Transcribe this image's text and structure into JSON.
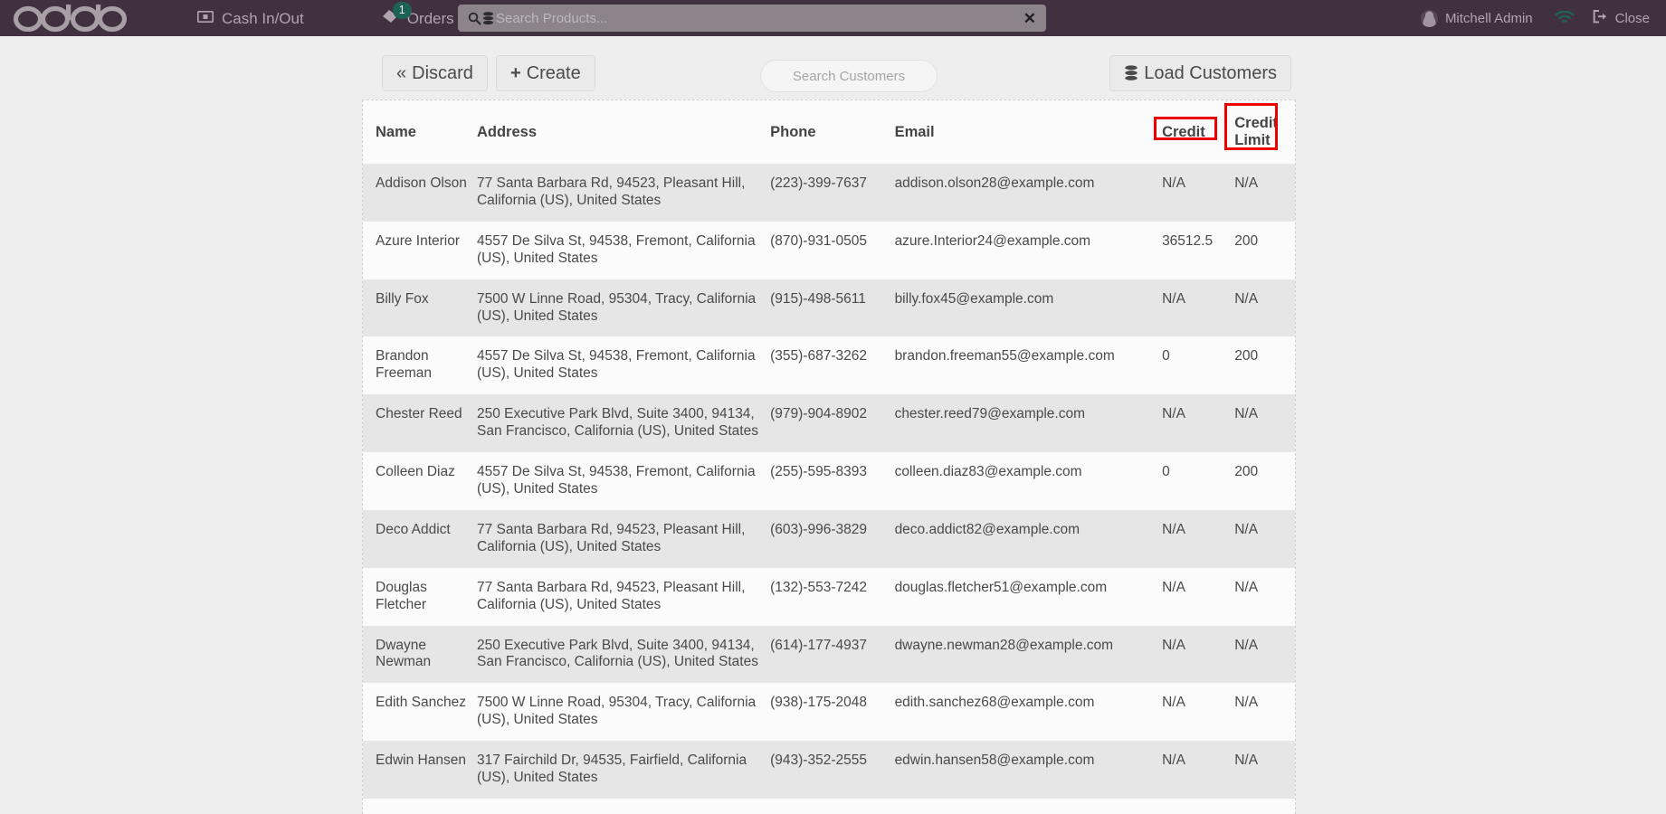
{
  "topbar": {
    "brand": "odoo",
    "cash_in_out": "Cash In/Out",
    "orders": "Orders",
    "orders_badge": "1",
    "search_placeholder": "Search Products...",
    "search_value": "",
    "user_name": "Mitchell Admin",
    "close_label": "Close",
    "bg_color": "#41303f",
    "text_color": "#b0a5af",
    "badge_color": "#1d6355"
  },
  "toolbar": {
    "discard_label": "Discard",
    "create_label": "Create",
    "search_customers_placeholder": "Search Customers",
    "load_customers_label": "Load Customers"
  },
  "table": {
    "headers": {
      "name": "Name",
      "address": "Address",
      "phone": "Phone",
      "email": "Email",
      "credit": "Credit",
      "credit_limit": "Credit Limit"
    },
    "highlight_color": "#ee0000",
    "rows": [
      {
        "name": "Addison Olson",
        "address": "77 Santa Barbara Rd, 94523, Pleasant Hill, California (US), United States",
        "phone": "(223)-399-7637",
        "email": "addison.olson28@example.com",
        "credit": "N/A",
        "credit_limit": "N/A",
        "limit_alert": false
      },
      {
        "name": "Azure Interior",
        "address": "4557 De Silva St, 94538, Fremont, California (US), United States",
        "phone": "(870)-931-0505",
        "email": "azure.Interior24@example.com",
        "credit": "36512.5",
        "credit_limit": "200",
        "limit_alert": true
      },
      {
        "name": "Billy Fox",
        "address": "7500 W Linne Road, 95304, Tracy, California (US), United States",
        "phone": "(915)-498-5611",
        "email": "billy.fox45@example.com",
        "credit": "N/A",
        "credit_limit": "N/A",
        "limit_alert": false
      },
      {
        "name": "Brandon Freeman",
        "address": "4557 De Silva St, 94538, Fremont, California (US), United States",
        "phone": "(355)-687-3262",
        "email": "brandon.freeman55@example.com",
        "credit": "0",
        "credit_limit": "200",
        "limit_alert": false
      },
      {
        "name": "Chester Reed",
        "address": "250 Executive Park Blvd, Suite 3400, 94134, San Francisco, California (US), United States",
        "phone": "(979)-904-8902",
        "email": "chester.reed79@example.com",
        "credit": "N/A",
        "credit_limit": "N/A",
        "limit_alert": false
      },
      {
        "name": "Colleen Diaz",
        "address": "4557 De Silva St, 94538, Fremont, California (US), United States",
        "phone": "(255)-595-8393",
        "email": "colleen.diaz83@example.com",
        "credit": "0",
        "credit_limit": "200",
        "limit_alert": false
      },
      {
        "name": "Deco Addict",
        "address": "77 Santa Barbara Rd, 94523, Pleasant Hill, California (US), United States",
        "phone": "(603)-996-3829",
        "email": "deco.addict82@example.com",
        "credit": "N/A",
        "credit_limit": "N/A",
        "limit_alert": false
      },
      {
        "name": "Douglas Fletcher",
        "address": "77 Santa Barbara Rd, 94523, Pleasant Hill, California (US), United States",
        "phone": "(132)-553-7242",
        "email": "douglas.fletcher51@example.com",
        "credit": "N/A",
        "credit_limit": "N/A",
        "limit_alert": false
      },
      {
        "name": "Dwayne Newman",
        "address": "250 Executive Park Blvd, Suite 3400, 94134, San Francisco, California (US), United States",
        "phone": "(614)-177-4937",
        "email": "dwayne.newman28@example.com",
        "credit": "N/A",
        "credit_limit": "N/A",
        "limit_alert": false
      },
      {
        "name": "Edith Sanchez",
        "address": "7500 W Linne Road, 95304, Tracy, California (US), United States",
        "phone": "(938)-175-2048",
        "email": "edith.sanchez68@example.com",
        "credit": "N/A",
        "credit_limit": "N/A",
        "limit_alert": false
      },
      {
        "name": "Edwin Hansen",
        "address": "317 Fairchild Dr, 94535, Fairfield, California (US), United States",
        "phone": "(943)-352-2555",
        "email": "edwin.hansen58@example.com",
        "credit": "N/A",
        "credit_limit": "N/A",
        "limit_alert": false
      }
    ]
  }
}
